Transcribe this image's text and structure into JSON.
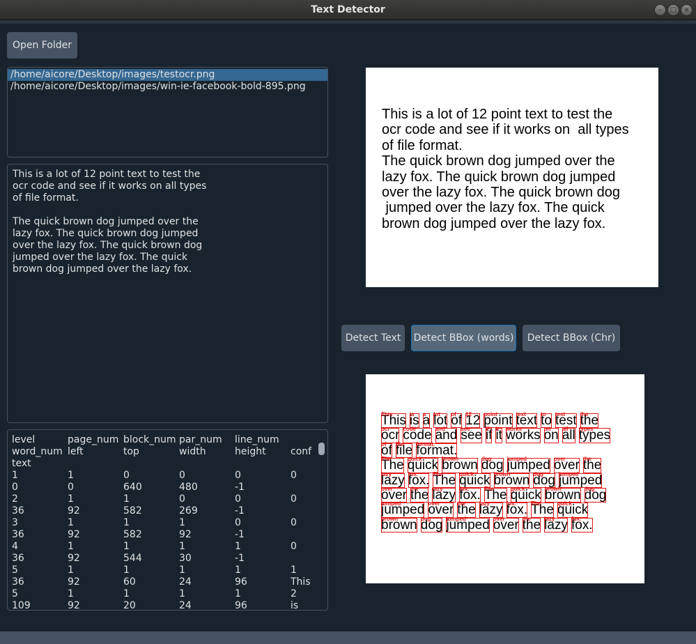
{
  "window": {
    "title": "Text Detector"
  },
  "toolbar": {
    "open_folder": "Open Folder"
  },
  "files": [
    "/home/aicore/Desktop/images/testocr.png",
    "/home/aicore/Desktop/images/win-ie-facebook-bold-895.png"
  ],
  "ocr_text_lines": [
    "This is a lot of 12 point text to test the",
    "ocr code and see if it works on all types",
    "of file format.",
    "",
    "The quick brown dog jumped over the",
    "lazy fox. The quick brown dog jumped",
    "over the lazy fox. The quick brown dog",
    "jumped over the lazy fox. The quick",
    "brown dog jumped over the lazy fox."
  ],
  "table": {
    "headers_row1": [
      "level",
      "page_num",
      "block_num",
      "par_num",
      "line_num",
      ""
    ],
    "headers_row2": [
      "word_num",
      "left",
      "top",
      "width",
      "height",
      "conf"
    ],
    "headers_row3": [
      "text",
      "",
      "",
      "",
      "",
      ""
    ],
    "rows": [
      [
        "1",
        "1",
        "0",
        "0",
        "0",
        "0"
      ],
      [
        "0",
        "0",
        "640",
        "480",
        "-1",
        ""
      ],
      [
        "2",
        "1",
        "1",
        "0",
        "0",
        "0"
      ],
      [
        "36",
        "92",
        "582",
        "269",
        "-1",
        ""
      ],
      [
        "3",
        "1",
        "1",
        "1",
        "0",
        "0"
      ],
      [
        "36",
        "92",
        "582",
        "92",
        "-1",
        ""
      ],
      [
        "4",
        "1",
        "1",
        "1",
        "1",
        "0"
      ],
      [
        "36",
        "92",
        "544",
        "30",
        "-1",
        ""
      ],
      [
        "5",
        "1",
        "1",
        "1",
        "1",
        "1"
      ],
      [
        "36",
        "92",
        "60",
        "24",
        "96",
        "This"
      ],
      [
        "5",
        "1",
        "1",
        "1",
        "1",
        "2"
      ],
      [
        "109",
        "92",
        "20",
        "24",
        "96",
        "is"
      ]
    ]
  },
  "preview_lines": [
    "This is a lot of 12 point text to test the",
    "ocr code and see if it works on  all types",
    "of file format.",
    "The quick brown dog jumped over the",
    "lazy fox. The quick brown dog jumped",
    "over the lazy fox. The quick brown dog",
    " jumped over the lazy fox. The quick",
    "brown dog jumped over the lazy fox."
  ],
  "actions": {
    "detect_text": "Detect Text",
    "detect_bbox_words": "Detect BBox (words)",
    "detect_bbox_chr": "Detect BBox (Chr)"
  },
  "bbox_result": {
    "lines": [
      [
        "This",
        "is",
        "a",
        "lot",
        "of",
        "12",
        "point",
        "text",
        "to",
        "test",
        "the"
      ],
      [
        "ocr",
        "code",
        "and",
        "see",
        "if",
        "it",
        "works",
        "on",
        "all",
        "types"
      ],
      [
        "of",
        "file",
        "format."
      ],
      [
        "The",
        "quick",
        "brown",
        "dog",
        "jumped",
        "over",
        "the"
      ],
      [
        "lazy",
        "fox.",
        "The",
        "quick",
        "brown",
        "dog",
        "jumped"
      ],
      [
        "over",
        "the",
        "lazy",
        "fox.",
        "The",
        "quick",
        "brown",
        "dog"
      ],
      [
        "jumped",
        "over",
        "the",
        "lazy",
        "fox.",
        "The",
        "quick"
      ],
      [
        "brown",
        "dog",
        "jumped",
        "over",
        "the",
        "lazy",
        "fox."
      ]
    ],
    "box_color": "#e01616"
  }
}
